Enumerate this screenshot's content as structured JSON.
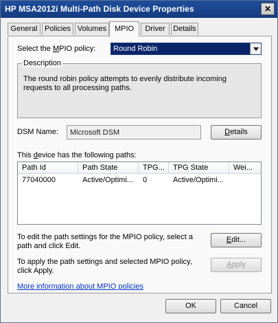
{
  "window": {
    "title": "HP MSA2012i  Multi-Path Disk Device Properties",
    "close_glyph": "✕"
  },
  "tabs": [
    {
      "label": "General"
    },
    {
      "label": "Policies"
    },
    {
      "label": "Volumes"
    },
    {
      "label": "MPIO",
      "active": true
    },
    {
      "label": "Driver"
    },
    {
      "label": "Details"
    }
  ],
  "policy": {
    "label_pre": "Select the ",
    "label_accel": "M",
    "label_post": "PIO policy:",
    "value": "Round Robin"
  },
  "description": {
    "legend": "Description",
    "text": "The round robin policy attempts to evenly distribute incoming requests to all processing paths."
  },
  "dsm": {
    "label": "DSM Name:",
    "value": "Microsoft DSM",
    "details_accel": "D",
    "details_rest": "etails"
  },
  "paths": {
    "label_pre": "This ",
    "label_accel": "d",
    "label_post": "evice has the following paths:",
    "columns": [
      "Path Id",
      "Path State",
      "TPG...",
      "TPG State",
      "Wei..."
    ],
    "rows": [
      [
        "77040000",
        "Active/Optimi...",
        "0",
        "Active/Optimi...",
        ""
      ]
    ]
  },
  "edit": {
    "text_line1": "To edit the path settings for the MPIO policy, select a",
    "text_line2": "path and click Edit.",
    "button_accel": "E",
    "button_rest": "dit..."
  },
  "apply": {
    "text_line1": "To apply the path settings and selected MPIO policy,",
    "text_line2": "click Apply.",
    "button_accel": "A",
    "button_rest": "pply"
  },
  "more_info_link": "More information about MPIO policies",
  "footer": {
    "ok": "OK",
    "cancel": "Cancel"
  }
}
